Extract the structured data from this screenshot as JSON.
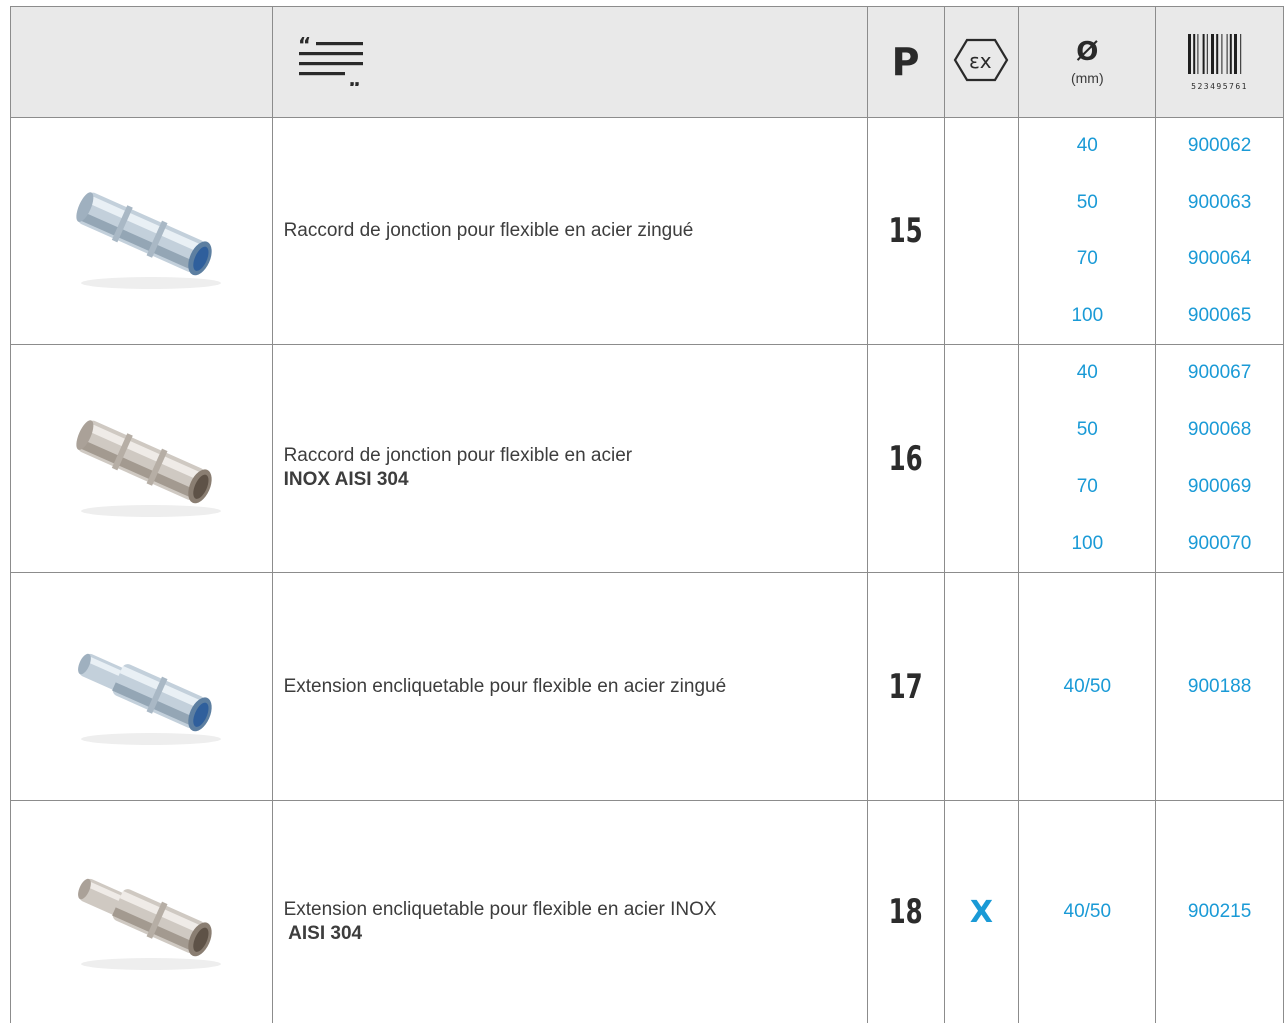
{
  "header": {
    "p_label": "P",
    "diameter_symbol": "Ø",
    "diameter_unit": "(mm)",
    "barcode_number": "523495761",
    "icons": [
      "quote-text-icon",
      "ex-atex-icon",
      "barcode-icon"
    ]
  },
  "rows": [
    {
      "image": "zinc-coupling-photo",
      "description": "Raccord de jonction pour flexible en acier zingué",
      "description_bold": "",
      "p": "15",
      "ex": "",
      "diameters": [
        "40",
        "50",
        "70",
        "100"
      ],
      "codes": [
        "900062",
        "900063",
        "900064",
        "900065"
      ]
    },
    {
      "image": "inox-coupling-photo",
      "description": "Raccord de jonction pour flexible en acier",
      "description_bold": "INOX AISI 304",
      "p": "16",
      "ex": "",
      "diameters": [
        "40",
        "50",
        "70",
        "100"
      ],
      "codes": [
        "900067",
        "900068",
        "900069",
        "900070"
      ]
    },
    {
      "image": "zinc-extension-photo",
      "description": "Extension encliquetable pour flexible en acier zingué",
      "description_bold": "",
      "p": "17",
      "ex": "",
      "diameters": [
        "40/50"
      ],
      "codes": [
        "900188"
      ]
    },
    {
      "image": "inox-extension-photo",
      "description": "Extension encliquetable pour flexible en acier INOX",
      "description_bold": " AISI 304",
      "p": "18",
      "ex": "X",
      "diameters": [
        "40/50"
      ],
      "codes": [
        "900215"
      ]
    }
  ],
  "colors": {
    "accent": "#1a9ad6",
    "header_bg": "#e9e9e9",
    "text": "#3d3d3d",
    "border": "#8c8c8c"
  }
}
